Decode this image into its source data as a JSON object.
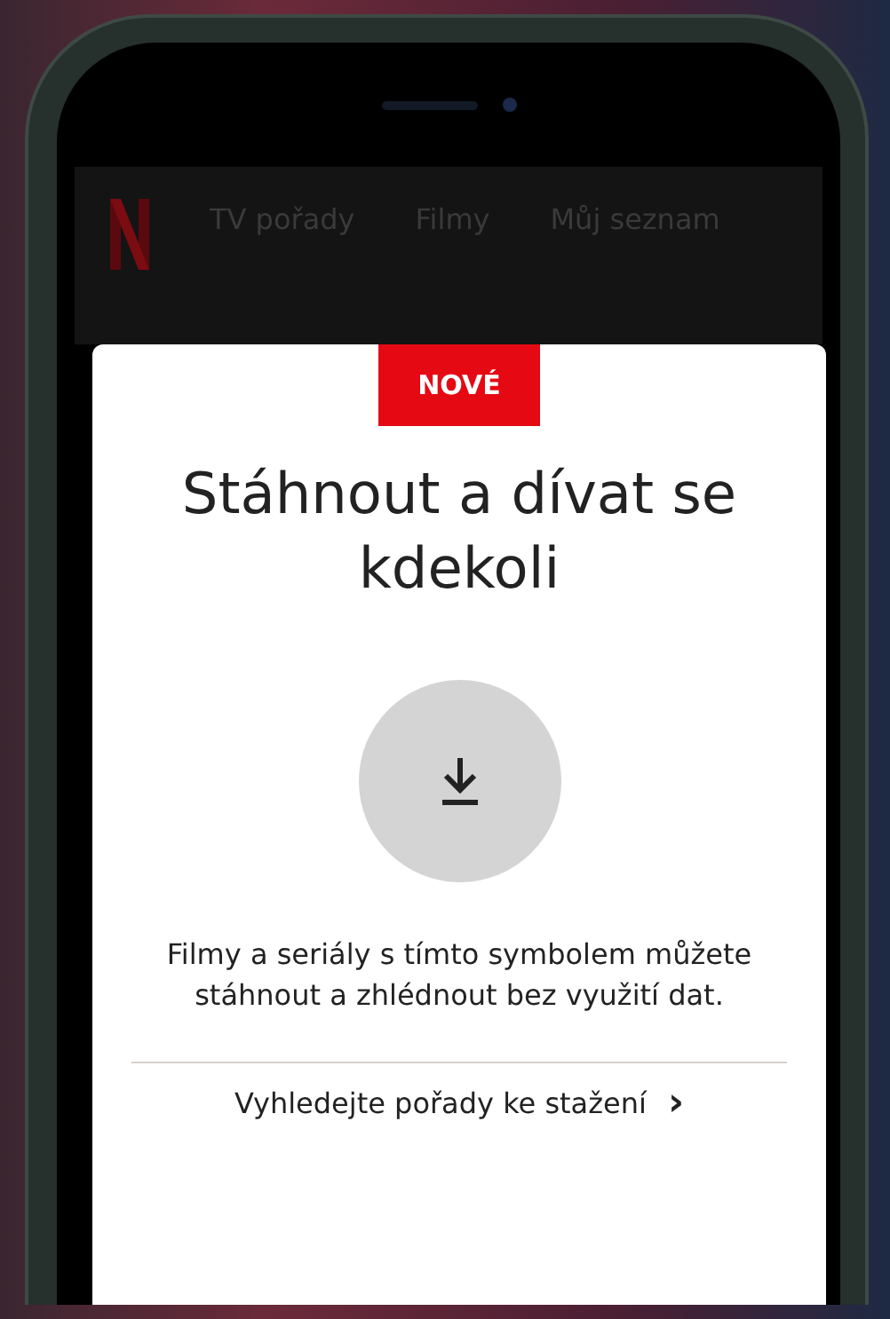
{
  "nav": {
    "tabs": [
      {
        "label": "TV pořady"
      },
      {
        "label": "Filmy"
      },
      {
        "label": "Můj seznam"
      }
    ]
  },
  "dialog": {
    "badge": "NOVÉ",
    "title": "Stáhnout a dívat se kdekoli",
    "description": "Filmy a seriály s tímto symbolem můžete stáhnout a zhlédnout bez využití dat.",
    "link": "Vyhledejte pořady ke stažení",
    "link_icon": "›"
  }
}
